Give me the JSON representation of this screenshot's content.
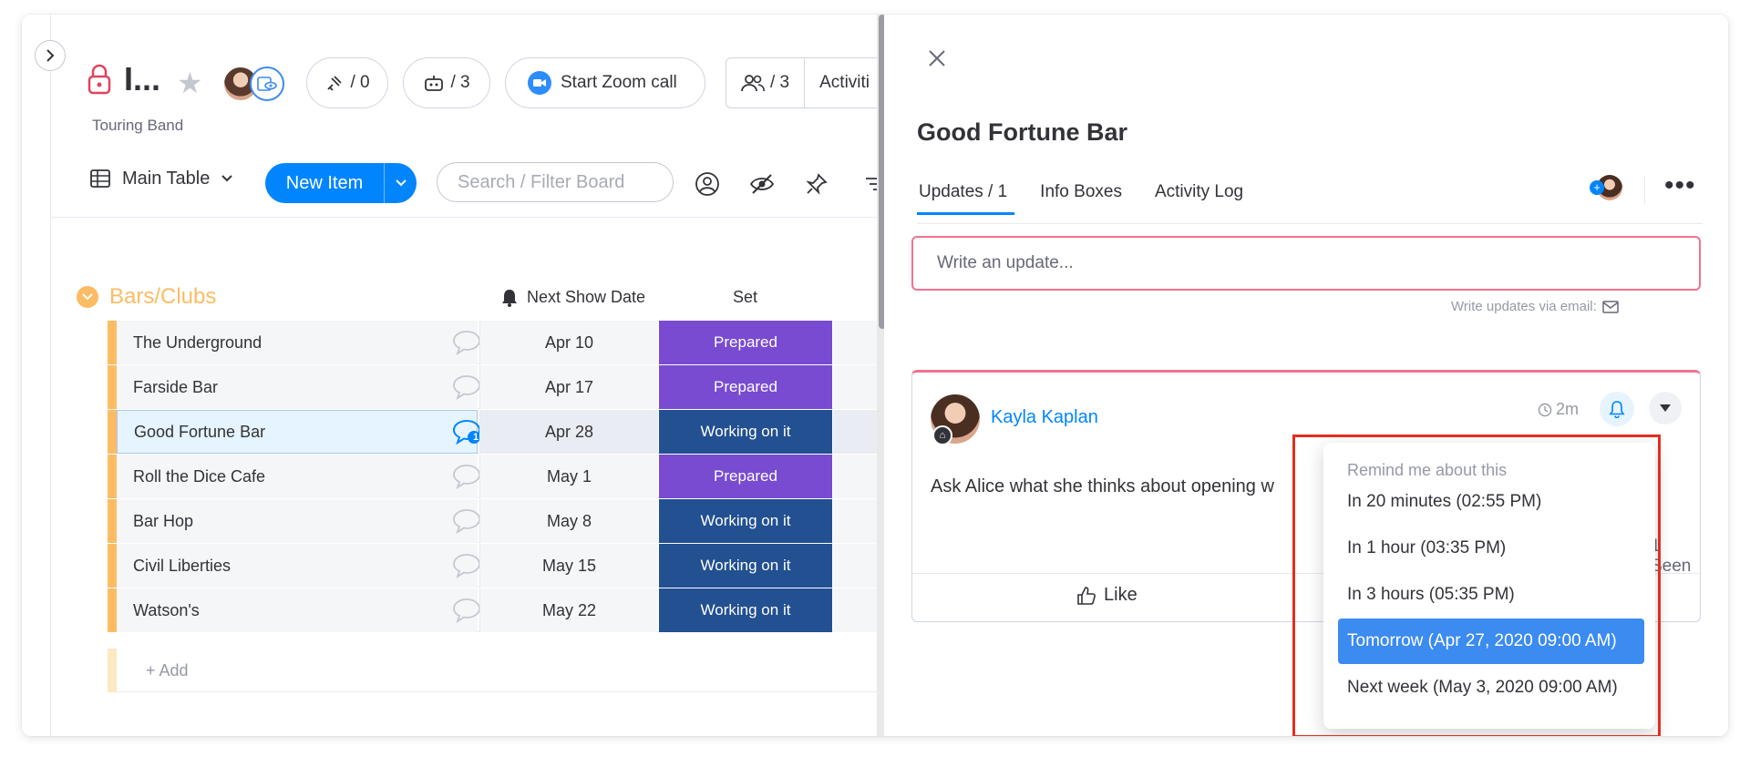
{
  "board": {
    "title": "I...",
    "subtitle": "Touring Band",
    "pills": {
      "integrations": "/ 0",
      "automations": "/ 3"
    },
    "zoom_label": "Start Zoom call",
    "members_count": "/ 3",
    "activity_label": "Activiti",
    "view_label": "Main Table",
    "new_item_label": "New Item",
    "search_placeholder": "Search / Filter Board"
  },
  "group": {
    "title": "Bars/Clubs",
    "color": "#fdbc64",
    "columns": {
      "date": "Next Show Date",
      "status": "Set"
    },
    "rows": [
      {
        "name": "The Underground",
        "date": "Apr 10",
        "status": "Prepared"
      },
      {
        "name": "Farside Bar",
        "date": "Apr 17",
        "status": "Prepared"
      },
      {
        "name": "Good Fortune Bar",
        "date": "Apr 28",
        "status": "Working on it",
        "updates": "1"
      },
      {
        "name": "Roll the Dice Cafe",
        "date": "May 1",
        "status": "Prepared"
      },
      {
        "name": "Bar Hop",
        "date": "May 8",
        "status": "Working on it"
      },
      {
        "name": "Civil Liberties",
        "date": "May 15",
        "status": "Working on it"
      },
      {
        "name": "Watson's",
        "date": "May 22",
        "status": "Working on it"
      }
    ],
    "add_label": "+ Add"
  },
  "status_colors": {
    "Prepared": "#784bd1",
    "Working on it": "#225091"
  },
  "panel": {
    "title": "Good Fortune Bar",
    "tabs": [
      "Updates / 1",
      "Info Boxes",
      "Activity Log"
    ],
    "compose_placeholder": "Write an update...",
    "email_hint": "Write updates via email:",
    "update": {
      "author": "Kayla Kaplan",
      "time": "2m",
      "text": "Ask Alice what she thinks about opening w",
      "seen": "1 Seen",
      "like_label": "Like"
    }
  },
  "reminder_menu": {
    "header": "Remind me about this",
    "options": [
      "In 20 minutes (02:55 PM)",
      "In 1 hour (03:35 PM)",
      "In 3 hours (05:35 PM)",
      "Tomorrow (Apr 27, 2020 09:00 AM)",
      "Next week (May 3, 2020 09:00 AM)"
    ],
    "active_index": 3
  }
}
